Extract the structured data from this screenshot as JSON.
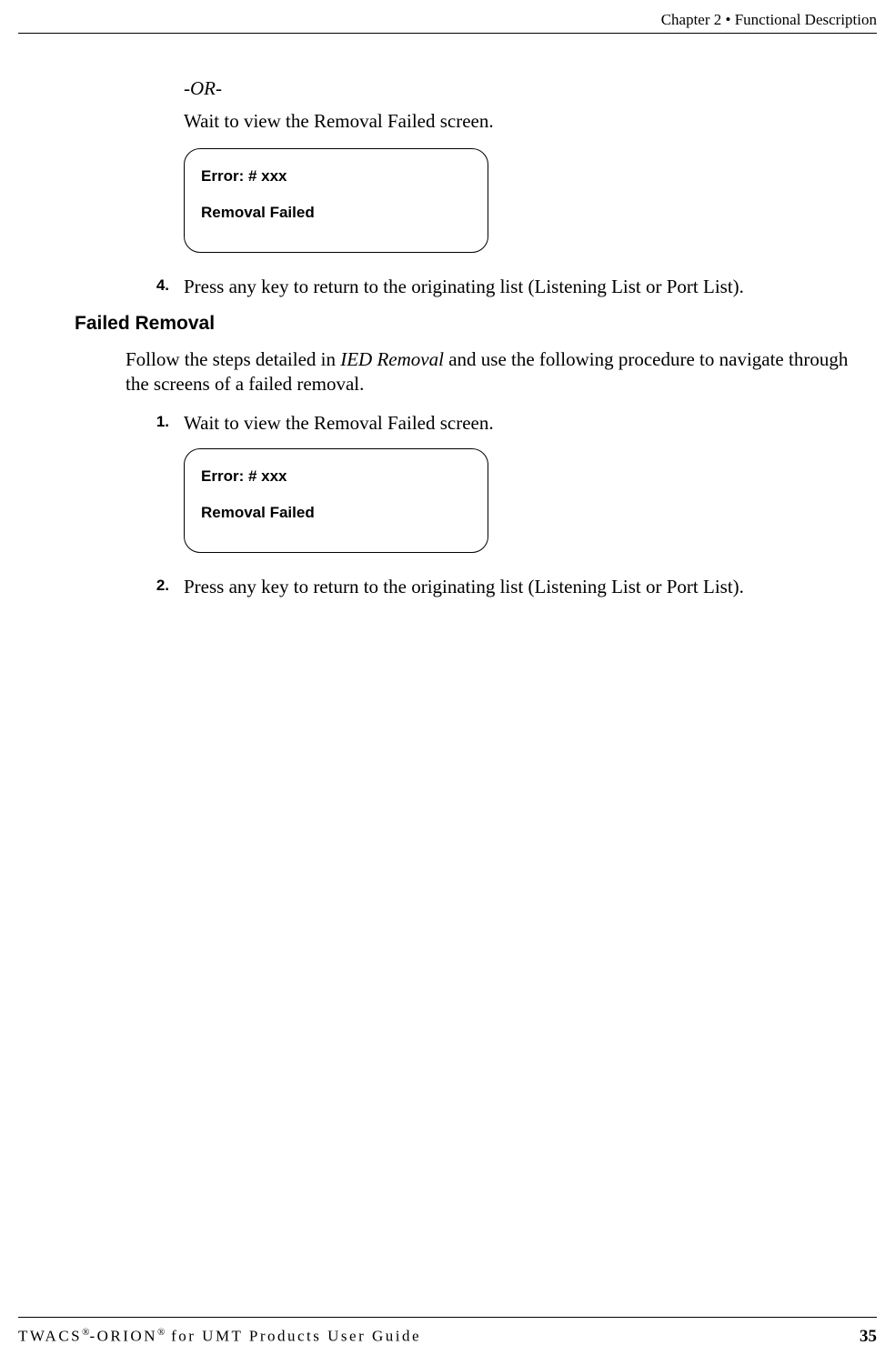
{
  "header": {
    "chapter": "Chapter 2 • Functional Description"
  },
  "content": {
    "or_text": "-OR-",
    "intro_wait": "Wait to view the Removal Failed screen.",
    "screen1": {
      "line1": "Error: # xxx",
      "line2": "Removal Failed"
    },
    "step4": {
      "num": "4.",
      "text": "Press any key to return to the originating list (Listening List or Port List)."
    },
    "section_heading": "Failed Removal",
    "intro_para_pre": "Follow the steps detailed in ",
    "intro_para_italic": "IED Removal",
    "intro_para_post": " and use the following procedure to navigate through the screens of a failed removal.",
    "step1": {
      "num": "1.",
      "text": "Wait to view the Removal Failed screen."
    },
    "screen2": {
      "line1": "Error: # xxx",
      "line2": "Removal Failed"
    },
    "step2": {
      "num": "2.",
      "text": "Press any key to return to the originating list (Listening List or Port List)."
    }
  },
  "footer": {
    "title_part1": "TWACS",
    "title_reg": "®",
    "title_part2": "-ORION",
    "title_suffix": " for UMT Products User Guide",
    "page_number": "35"
  }
}
